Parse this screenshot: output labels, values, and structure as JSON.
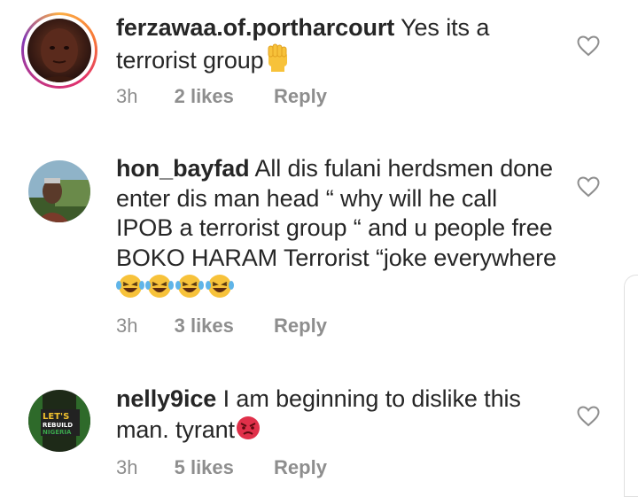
{
  "comments": [
    {
      "username": "ferzawaa.of.portharcourt",
      "text": "Yes its a terrorist group",
      "emoji_line_end": "raised-fist",
      "time": "3h",
      "likes": "2 likes",
      "reply": "Reply"
    },
    {
      "username": "hon_bayfad",
      "text": "All dis fulani herdsmen done enter dis man head “ why will he call IPOB a terrorist group “ and u people free BOKO HARAM Terrorist “joke everywhere",
      "emoji_line_end": "laughing-tears x4",
      "time": "3h",
      "likes": "3 likes",
      "reply": "Reply"
    },
    {
      "username": "nelly9ice",
      "text": "I am beginning to dislike this man. tyrant",
      "emoji_line_end": "angry-face",
      "time": "3h",
      "likes": "5 likes",
      "reply": "Reply",
      "avatar_text": "LET'S REBUILD NIGERIA"
    }
  ],
  "colors": {
    "text": "#262626",
    "meta": "#8e8e8e",
    "ring_start": "#fcaf45",
    "ring_end": "#833ab4"
  }
}
